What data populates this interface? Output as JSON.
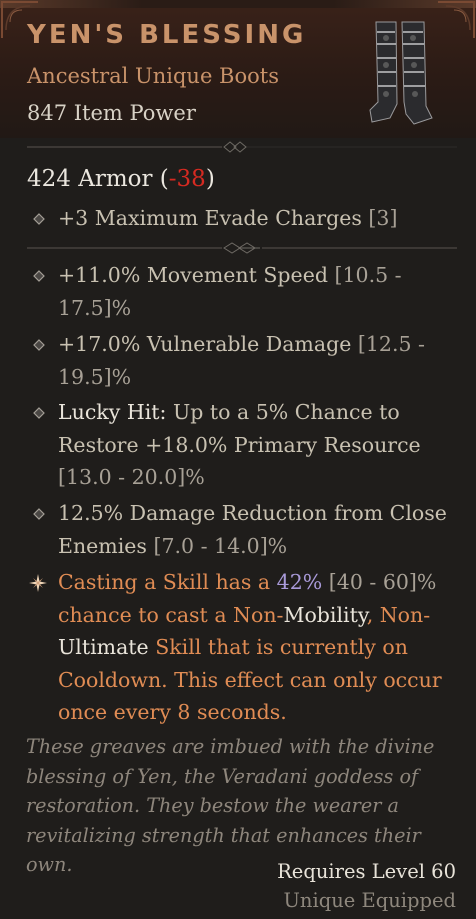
{
  "item": {
    "name": "YEN'S BLESSING",
    "type": "Ancestral Unique Boots",
    "power": "847 Item Power",
    "icon": "boots-icon"
  },
  "armor": {
    "value": "424 Armor",
    "open": "(",
    "delta": "-38",
    "close": ")"
  },
  "implicit": {
    "text": "+3 Maximum Evade Charges",
    "range": "[3]"
  },
  "affixes": [
    {
      "text": "+11.0% Movement Speed",
      "range": "[10.5 - 17.5]%"
    },
    {
      "text": "+17.0% Vulnerable Damage",
      "range": "[12.5 - 19.5]%"
    },
    {
      "label": "Lucky Hit:",
      "text": "Up to a 5% Chance to Restore +18.0% Primary Resource",
      "range": "[13.0 - 20.0]%"
    },
    {
      "text": "12.5% Damage Reduction from Close Enemies",
      "range": "[7.0 - 14.0]%"
    }
  ],
  "unique_power": {
    "part1": "Casting a Skill has a",
    "value": "42%",
    "range": "[40 - 60]%",
    "part2": "chance to cast a Non-",
    "word_mobility": "Mobility",
    "part3": ", Non-",
    "word_ultimate": "Ultimate",
    "part4": "Skill that is currently on Cooldown. This effect can only occur once every 8 seconds."
  },
  "flavor": "These greaves are imbued with the divine blessing of Yen, the Veradani goddess of restoration. They bestow the wearer a revitalizing strength that enhances their own.",
  "requirements": {
    "level": "Requires Level 60",
    "equip": "Unique Equipped"
  },
  "colors": {
    "name": "#c9936a",
    "delta": "#d52a21",
    "unique": "#e08c54",
    "value_highlight": "#a99ad9"
  }
}
